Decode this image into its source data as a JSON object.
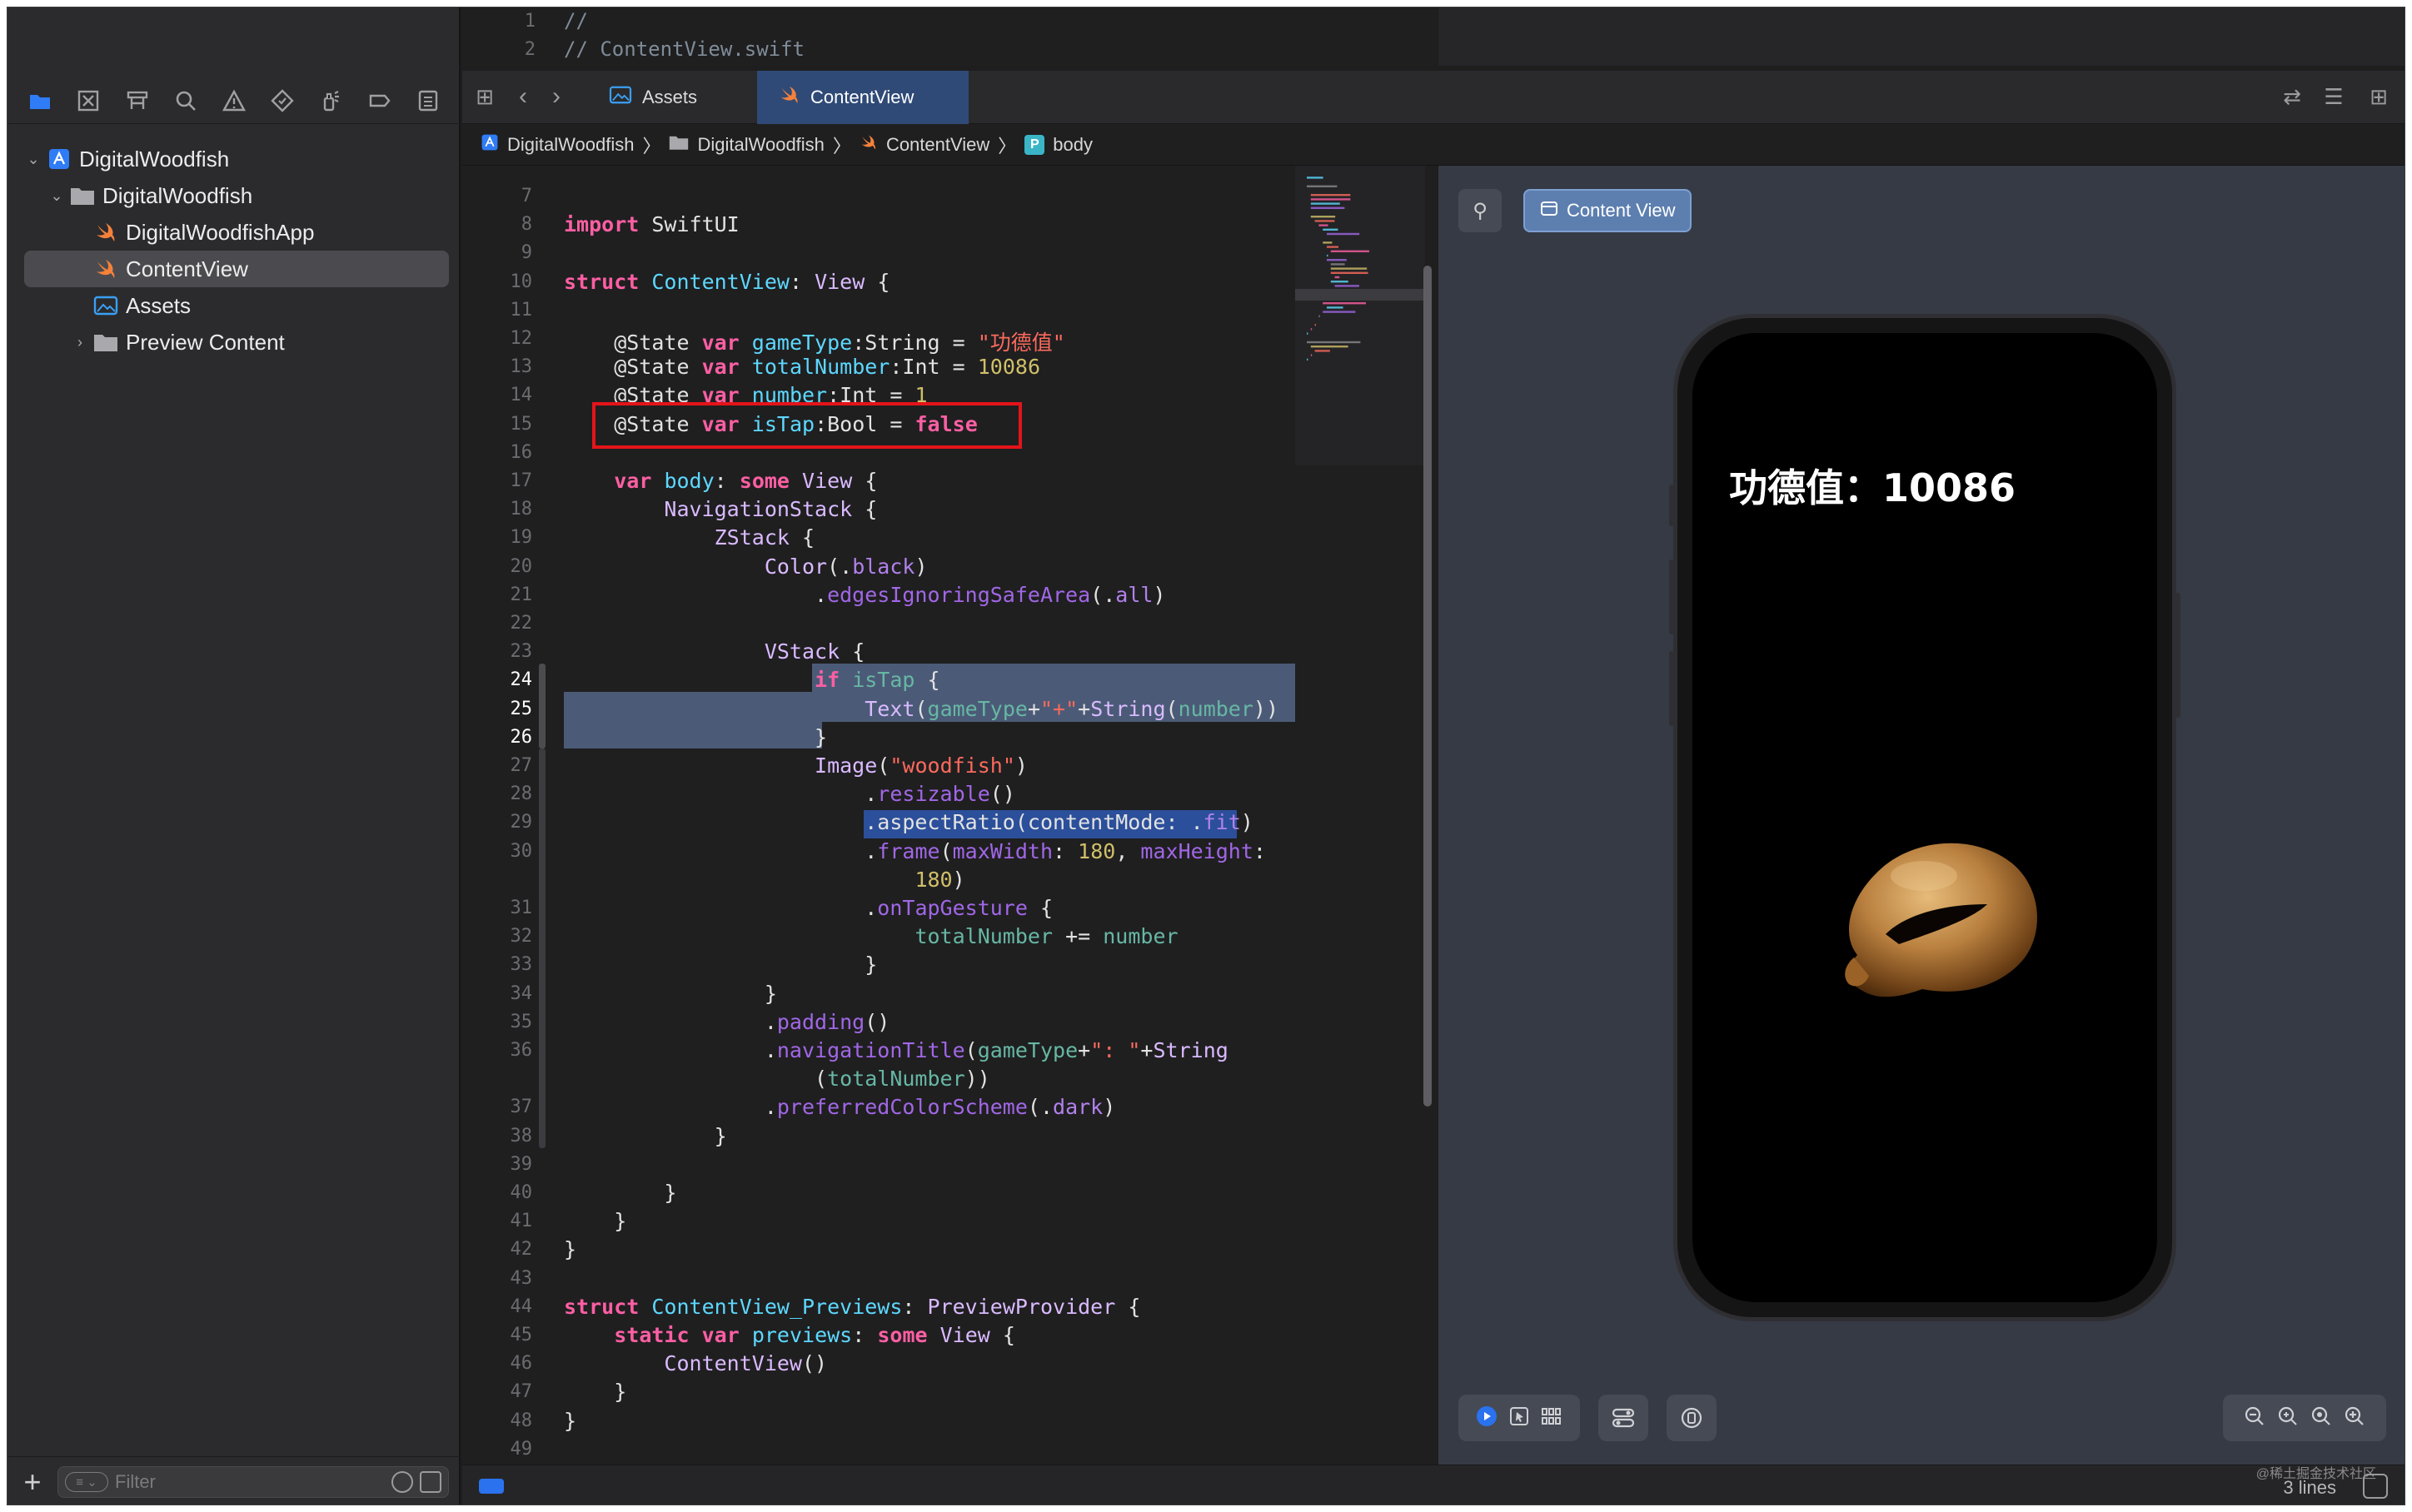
{
  "top_strip": {
    "lines": [
      {
        "num": "1",
        "text": "//"
      },
      {
        "num": "2",
        "text": "//  ContentView.swift"
      }
    ]
  },
  "sidebar": {
    "tree": [
      {
        "label": "DigitalWoodfish",
        "icon": "xcode-project-icon",
        "indent": 0,
        "disclosure": "open"
      },
      {
        "label": "DigitalWoodfish",
        "icon": "folder-icon",
        "indent": 1,
        "disclosure": "open"
      },
      {
        "label": "DigitalWoodfishApp",
        "icon": "swift-file-icon",
        "indent": 2,
        "disclosure": ""
      },
      {
        "label": "ContentView",
        "icon": "swift-file-icon",
        "indent": 2,
        "disclosure": "",
        "selected": true
      },
      {
        "label": "Assets",
        "icon": "asset-catalog-icon",
        "indent": 2,
        "disclosure": ""
      },
      {
        "label": "Preview Content",
        "icon": "folder-icon",
        "indent": 2,
        "disclosure": "closed"
      }
    ],
    "filter_placeholder": "Filter"
  },
  "tabs": [
    {
      "label": "Assets",
      "icon": "asset-catalog-icon",
      "active": false
    },
    {
      "label": "ContentView",
      "icon": "swift-file-icon",
      "active": true
    }
  ],
  "breadcrumb": [
    "DigitalWoodfish",
    "DigitalWoodfish",
    "ContentView",
    "body"
  ],
  "editor": {
    "current_lines": [
      "24",
      "25",
      "26"
    ]
  },
  "canvas": {
    "tab_label": "Content View",
    "screen_title": "功德值：10086"
  },
  "status": {
    "lines_text": "3 lines",
    "watermark": "@稀土掘金技术社区"
  },
  "colors": {
    "accent": "#2a72ee",
    "highlight_box": "#e3141a",
    "selection": "#4b5b77",
    "keyword": "#fc5fa3",
    "type": "#5dd8ff",
    "string": "#fc6a5d",
    "number": "#d0bf69"
  }
}
